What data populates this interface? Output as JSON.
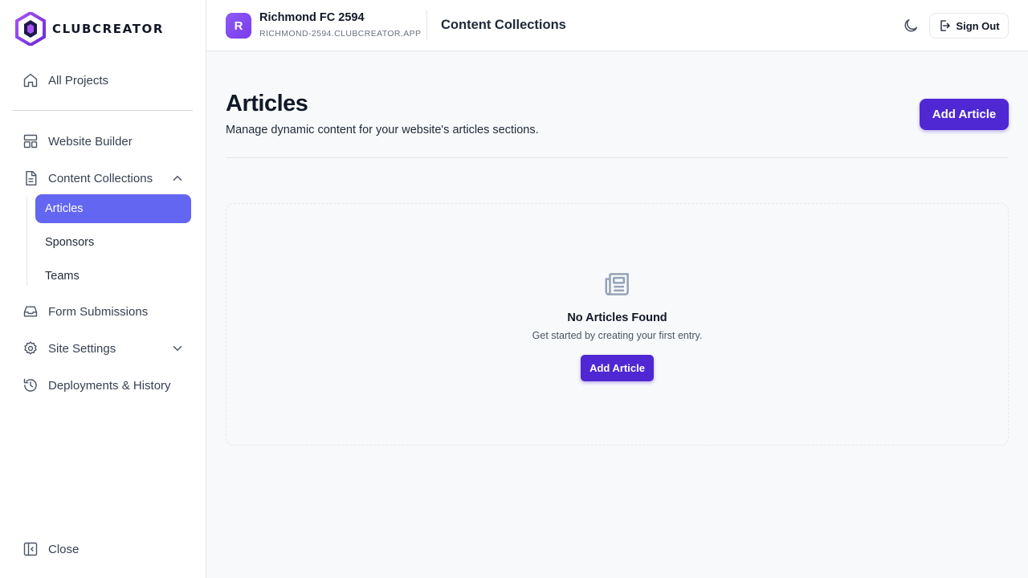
{
  "brand": {
    "name": "CLUBCREATOR",
    "accent": "#6366f1",
    "primary_button": "#4f28d3"
  },
  "sidebar": {
    "all_projects": "All Projects",
    "website_builder": "Website Builder",
    "content_collections": "Content Collections",
    "collections": [
      {
        "label": "Articles",
        "active": true
      },
      {
        "label": "Sponsors",
        "active": false
      },
      {
        "label": "Teams",
        "active": false
      }
    ],
    "form_submissions": "Form Submissions",
    "site_settings": "Site Settings",
    "deployments": "Deployments & History",
    "close": "Close",
    "icons": [
      "home-icon",
      "layout-icon",
      "document-icon",
      "inbox-icon",
      "gear-icon",
      "history-icon",
      "sidebar-collapse-icon"
    ]
  },
  "header": {
    "project_initial": "R",
    "project_name": "Richmond FC 2594",
    "project_domain": "RICHMOND-2594.CLUBCREATOR.APP",
    "section_title": "Content Collections",
    "sign_out": "Sign Out"
  },
  "main": {
    "title": "Articles",
    "description": "Manage dynamic content for your website's articles sections.",
    "add_button": "Add Article",
    "empty": {
      "icon": "newspaper-icon",
      "title": "No Articles Found",
      "subtitle": "Get started by creating your first entry.",
      "button": "Add Article"
    }
  }
}
